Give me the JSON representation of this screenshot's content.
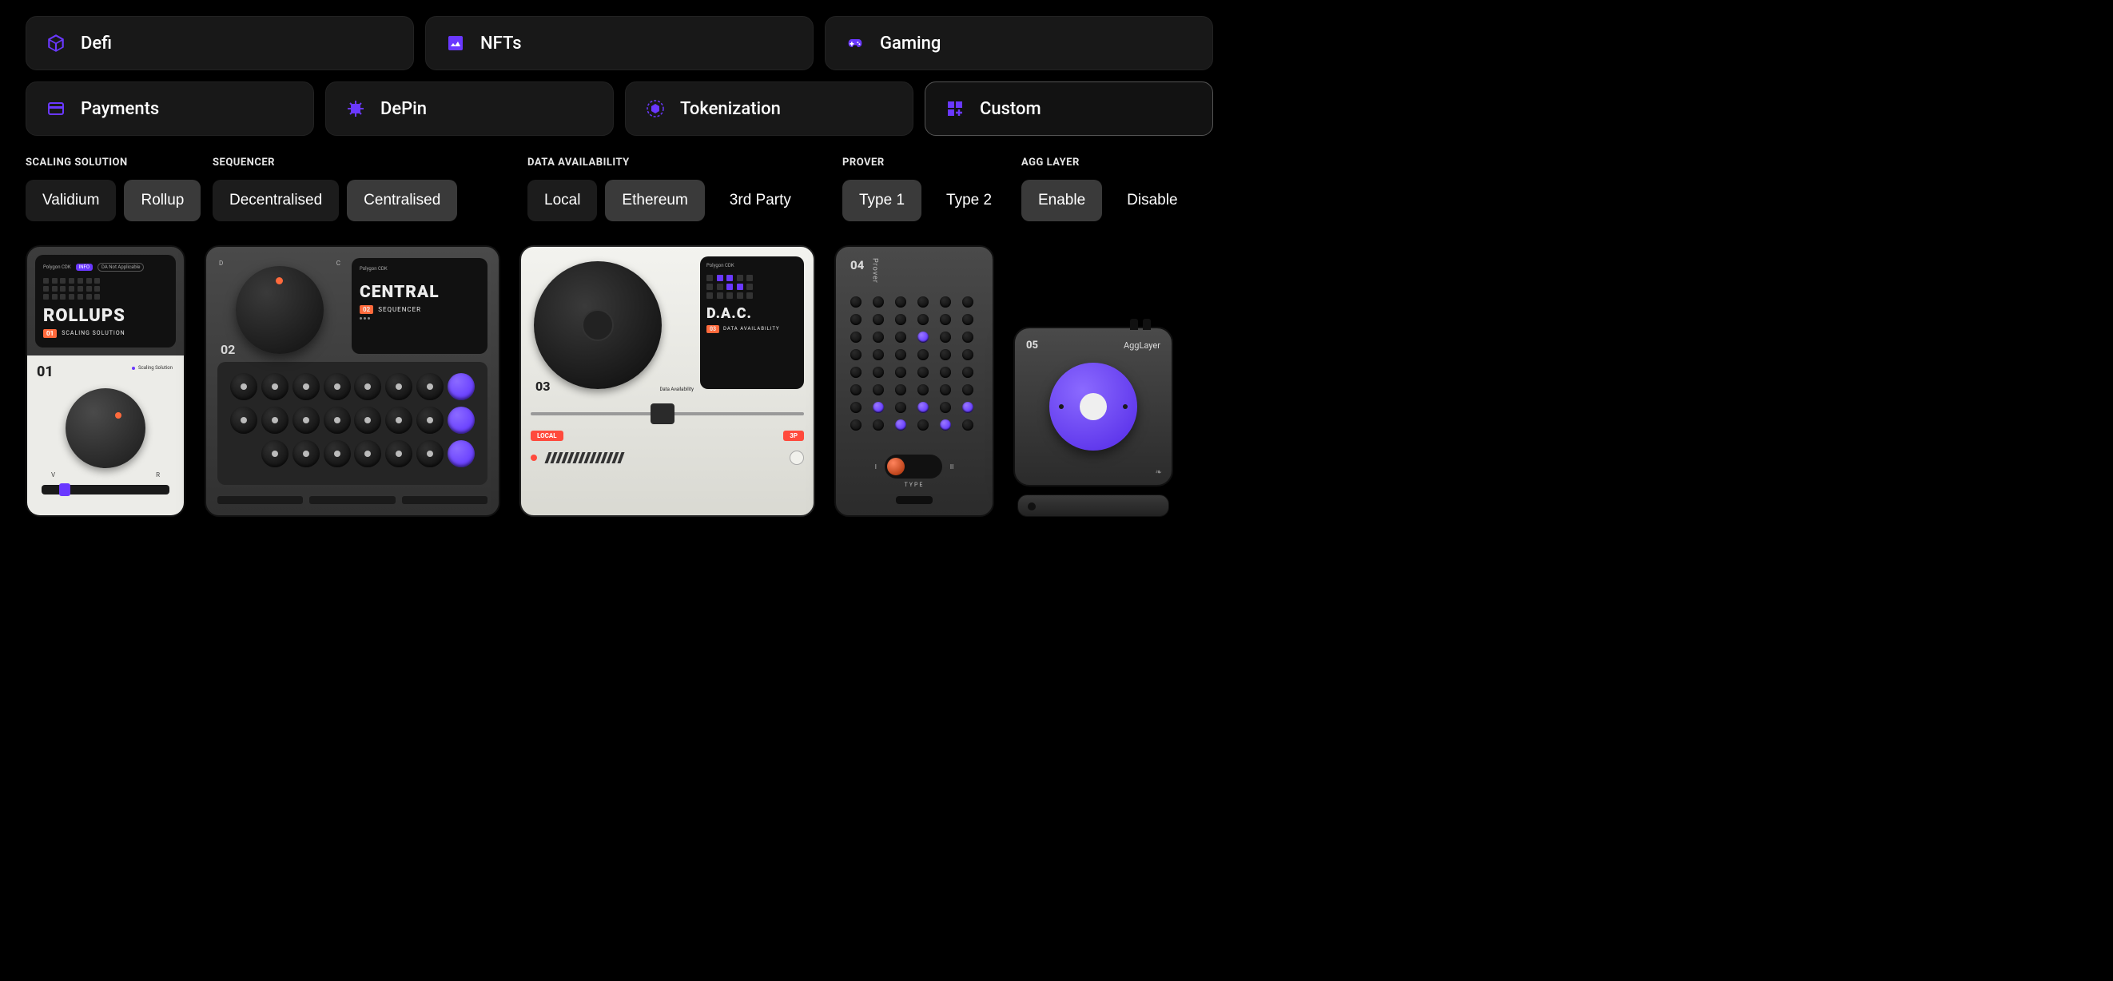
{
  "categories": {
    "row1": [
      {
        "name": "defi",
        "label": "Defi",
        "icon": "cube"
      },
      {
        "name": "nfts",
        "label": "NFTs",
        "icon": "image"
      },
      {
        "name": "gaming",
        "label": "Gaming",
        "icon": "gamepad"
      }
    ],
    "row2": [
      {
        "name": "payments",
        "label": "Payments",
        "icon": "card"
      },
      {
        "name": "depin",
        "label": "DePin",
        "icon": "chip"
      },
      {
        "name": "tokenization",
        "label": "Tokenization",
        "icon": "hexagon"
      },
      {
        "name": "custom",
        "label": "Custom",
        "icon": "grid-plus",
        "selected": true
      }
    ]
  },
  "config": {
    "scaling": {
      "title": "SCALING SOLUTION",
      "options": [
        "Validium",
        "Rollup"
      ],
      "active": "Rollup"
    },
    "sequencer": {
      "title": "SEQUENCER",
      "options": [
        "Decentralised",
        "Centralised"
      ],
      "active": "Centralised"
    },
    "da": {
      "title": "DATA AVAILABILITY",
      "options": [
        "Local",
        "Ethereum",
        "3rd Party"
      ],
      "active": "Ethereum"
    },
    "prover": {
      "title": "PROVER",
      "options": [
        "Type 1",
        "Type 2"
      ],
      "active": "Type 1"
    },
    "agg": {
      "title": "AGG LAYER",
      "options": [
        "Enable",
        "Disable"
      ],
      "active": "Enable"
    }
  },
  "devices": {
    "d01": {
      "brand": "Polygon CDK",
      "tag1": "INFO",
      "tag2": "DA Not Applicable",
      "headline": "ROLLUPS",
      "index": "01",
      "subtitle": "SCALING SOLUTION",
      "panel_index": "01",
      "panel_tag": "Scaling Solution",
      "v": "V",
      "r": "R"
    },
    "d02": {
      "index": "02",
      "d": "D",
      "c": "C",
      "brand": "Polygon CDK",
      "headline": "CENTRAL",
      "sub_index": "02",
      "subtitle": "SEQUENCER"
    },
    "d03": {
      "index": "03",
      "da_label": "Data Availability",
      "brand": "Polygon CDK",
      "headline": "D.A.C.",
      "sub_index": "03",
      "subtitle": "DATA AVAILABILITY",
      "left_label": "LOCAL",
      "right_label": "3P"
    },
    "d04": {
      "index": "04",
      "label": "Prover",
      "mark_l": "I",
      "mark_r": "II",
      "type_label": "TYPE"
    },
    "d05": {
      "index": "05",
      "label": "AggLayer"
    }
  }
}
